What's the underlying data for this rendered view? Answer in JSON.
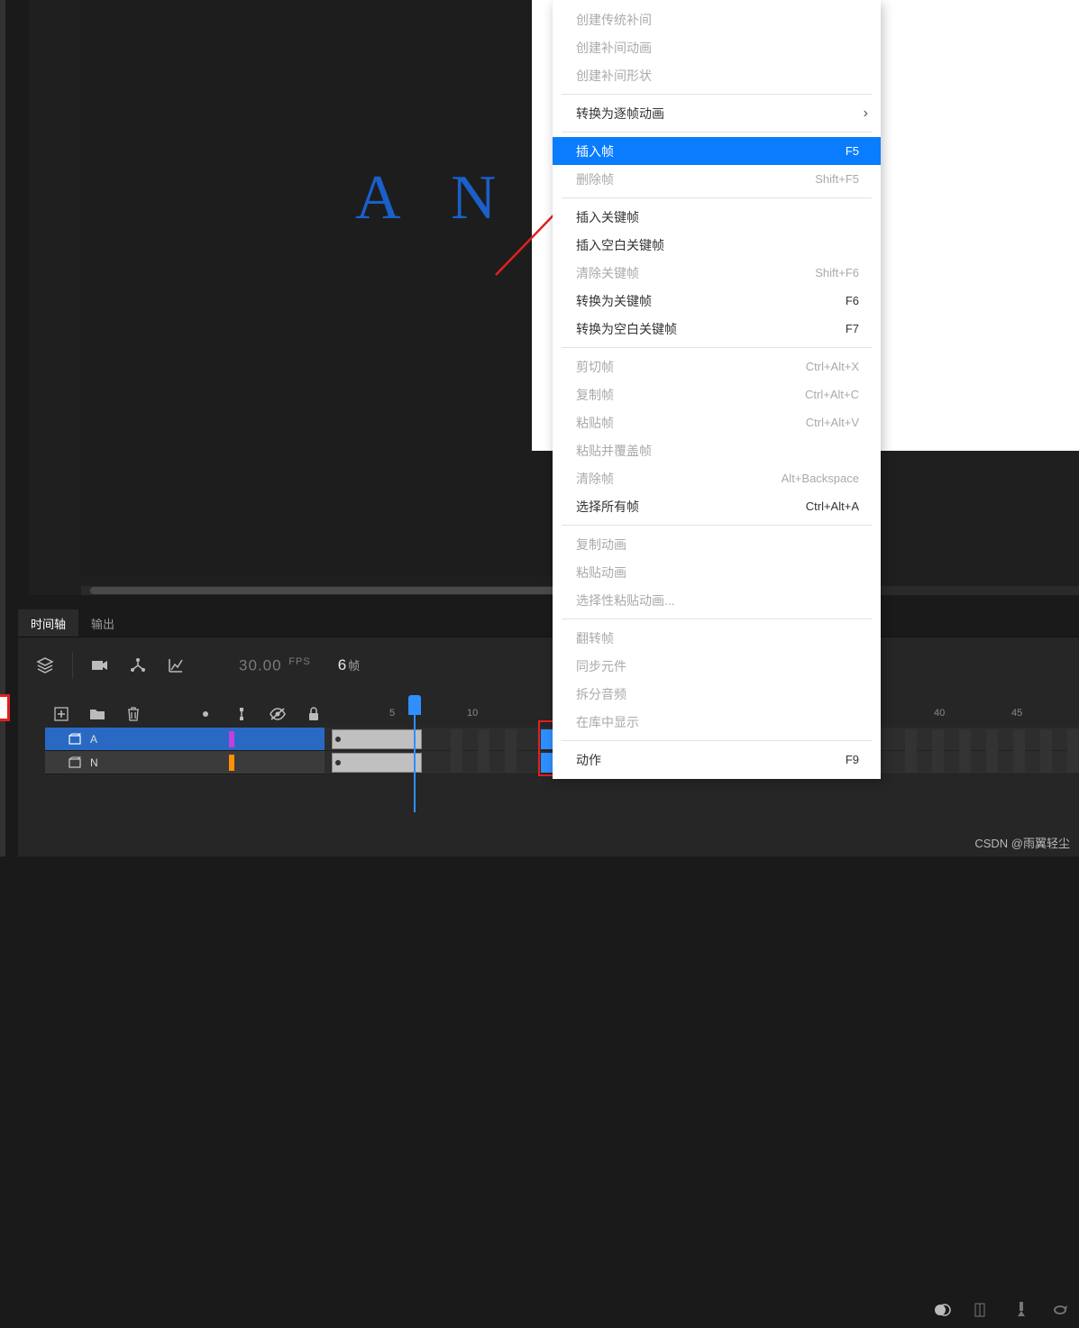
{
  "stage": {
    "letter_a": "A",
    "letter_n": "N"
  },
  "tabs": {
    "timeline": "时间轴",
    "output": "输出"
  },
  "timeline": {
    "fps_value": "30.00",
    "fps_label": "FPS",
    "current_frame": "6",
    "frame_label": "帧",
    "ruler": [
      "5",
      "10",
      "40",
      "45"
    ],
    "layers": [
      {
        "name": "A",
        "selected": true,
        "color": "#c040e0"
      },
      {
        "name": "N",
        "selected": false,
        "color": "#ff9000"
      }
    ]
  },
  "context_menu": {
    "items": [
      {
        "label": "创建传统补间",
        "enabled": false
      },
      {
        "label": "创建补间动画",
        "enabled": false
      },
      {
        "label": "创建补间形状",
        "enabled": false
      },
      {
        "sep": true
      },
      {
        "label": "转换为逐帧动画",
        "enabled": true,
        "submenu": true
      },
      {
        "sep": true
      },
      {
        "label": "插入帧",
        "enabled": true,
        "shortcut": "F5",
        "highlight": true
      },
      {
        "label": "删除帧",
        "enabled": false,
        "shortcut": "Shift+F5"
      },
      {
        "sep": true
      },
      {
        "label": "插入关键帧",
        "enabled": true
      },
      {
        "label": "插入空白关键帧",
        "enabled": true
      },
      {
        "label": "清除关键帧",
        "enabled": false,
        "shortcut": "Shift+F6"
      },
      {
        "label": "转换为关键帧",
        "enabled": true,
        "shortcut": "F6"
      },
      {
        "label": "转换为空白关键帧",
        "enabled": true,
        "shortcut": "F7"
      },
      {
        "sep": true
      },
      {
        "label": "剪切帧",
        "enabled": false,
        "shortcut": "Ctrl+Alt+X"
      },
      {
        "label": "复制帧",
        "enabled": false,
        "shortcut": "Ctrl+Alt+C"
      },
      {
        "label": "粘贴帧",
        "enabled": false,
        "shortcut": "Ctrl+Alt+V"
      },
      {
        "label": "粘贴并覆盖帧",
        "enabled": false
      },
      {
        "label": "清除帧",
        "enabled": false,
        "shortcut": "Alt+Backspace"
      },
      {
        "label": "选择所有帧",
        "enabled": true,
        "shortcut": "Ctrl+Alt+A"
      },
      {
        "sep": true
      },
      {
        "label": "复制动画",
        "enabled": false
      },
      {
        "label": "粘贴动画",
        "enabled": false
      },
      {
        "label": "选择性粘贴动画...",
        "enabled": false
      },
      {
        "sep": true
      },
      {
        "label": "翻转帧",
        "enabled": false
      },
      {
        "label": "同步元件",
        "enabled": false
      },
      {
        "label": "拆分音频",
        "enabled": false
      },
      {
        "label": "在库中显示",
        "enabled": false
      },
      {
        "sep": true
      },
      {
        "label": "动作",
        "enabled": true,
        "shortcut": "F9"
      }
    ]
  },
  "watermark": "CSDN @雨翼轻尘"
}
